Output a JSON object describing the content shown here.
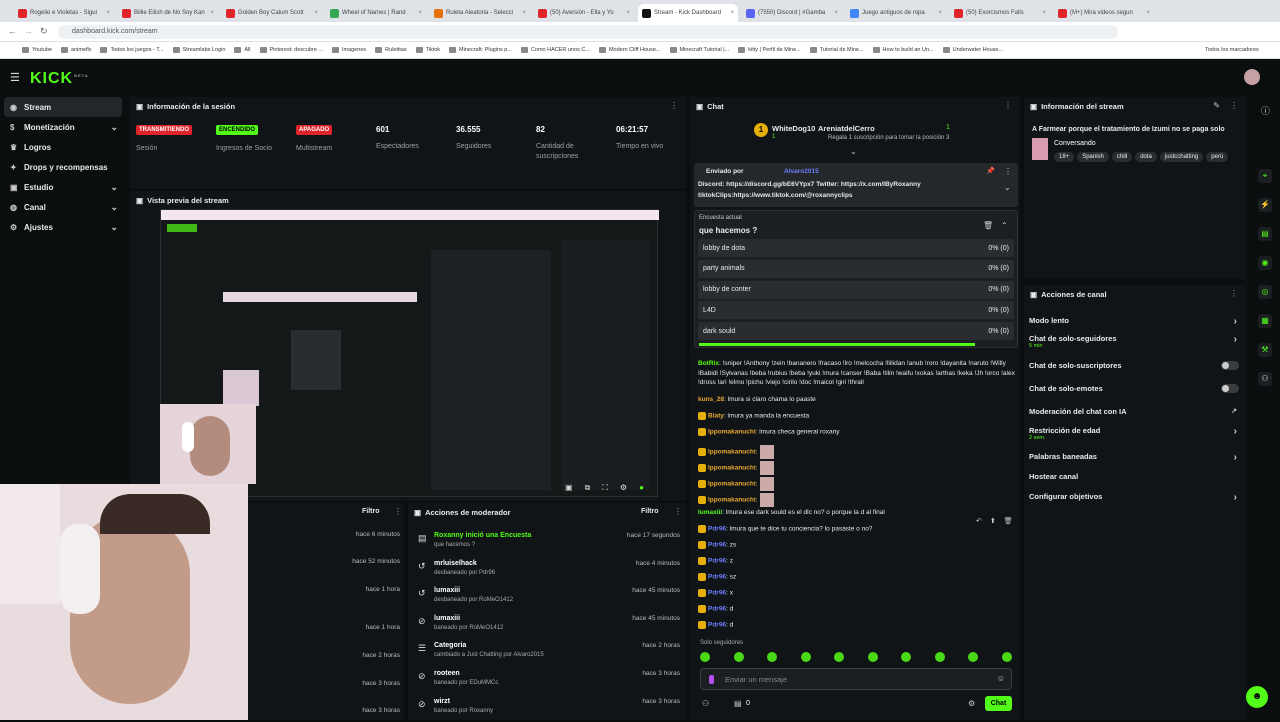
{
  "browser": {
    "tabs": [
      "Rogelio e Violetas - Sigui",
      "Billie Eilish de No Soy Kan",
      "Golden Boy Calum Scott",
      "Wheel of Names | Rand",
      "Ruleta Aleatoria - Selecci",
      "(50) Aversión - Ella y Yo",
      "Stream - Kick Dashboard",
      "(7550) Discord | #Gamba",
      "Juego antiguos de ropa",
      "(50) Exorcismos Falls",
      "(M+) Mira videos segun"
    ],
    "url": "dashboard.kick.com/stream",
    "bookmarks": [
      "Youtube",
      "animeflv",
      "Todos los juegos - T...",
      "Streamlabs Login",
      "All",
      "Pinterest: descubre ...",
      "Imagenes",
      "Ruletitas",
      "Tiktok",
      "Minecraft: Plugins p...",
      "Como HACER unos C...",
      "Modern Cliff House...",
      "Minecraft Tutorial |...",
      "kitty | Perfil de Mine...",
      "Tutorial de Mine...",
      "How to build an Un...",
      "Underwater House..."
    ],
    "bookmarks_right": "Todos los marcadores"
  },
  "kick": {
    "logo": "KICK",
    "beta": "BETA"
  },
  "sidebar": [
    {
      "label": "Stream",
      "icon": "broadcast-icon",
      "active": true
    },
    {
      "label": "Monetización",
      "icon": "money-icon",
      "chev": true
    },
    {
      "label": "Logros",
      "icon": "trophy-icon"
    },
    {
      "label": "Drops y recompensas",
      "icon": "gift-icon"
    },
    {
      "label": "Estudio",
      "icon": "studio-icon",
      "chev": true
    },
    {
      "label": "Canal",
      "icon": "user-icon",
      "chev": true
    },
    {
      "label": "Ajustes",
      "icon": "gear-icon",
      "chev": true
    }
  ],
  "session": {
    "title": "Información de la sesión",
    "badges": [
      {
        "label": "TRANSMITIENDO",
        "sub": "Sesión",
        "color": "#e0242b"
      },
      {
        "label": "ENCENDIDO",
        "sub": "Ingresos de Socio",
        "color": "#53fc18"
      },
      {
        "label": "APAGADO",
        "sub": "Multistream",
        "color": "#e0242b"
      }
    ],
    "stats": [
      {
        "value": "601",
        "label": "Espectadores"
      },
      {
        "value": "36.555",
        "label": "Seguidores"
      },
      {
        "value": "82",
        "label": "Cantidad de suscripciones"
      },
      {
        "value": "06:21:57",
        "label": "Tiempo en vivo"
      }
    ]
  },
  "preview": {
    "title": "Vista previa del stream"
  },
  "left_panel": {
    "filter": "Filtro",
    "times": [
      "hace 6 minutos",
      "hace 52 minutos",
      "hace 1 hora",
      "hace 1 hora",
      "hace 2 horas",
      "hace 3 horas",
      "hace 3 horas"
    ]
  },
  "mod_actions": {
    "title": "Acciones de moderador",
    "filter": "Filtro",
    "items": [
      {
        "title": "Roxanny inició una Encuesta",
        "desc": "que hacemos ?",
        "time": "hace 17 segundos",
        "icon": "poll-icon"
      },
      {
        "title": "mrluiselhack",
        "desc": "desbaneado por Pdr96",
        "time": "hace 4 minutos",
        "icon": "unban-icon"
      },
      {
        "title": "lumaxiii",
        "desc": "desbaneado por RoMeO1412",
        "time": "hace 45 minutos",
        "icon": "unban-icon"
      },
      {
        "title": "lumaxiii",
        "desc": "baneado por RoMeO1412",
        "time": "hace 45 minutos",
        "icon": "ban-icon"
      },
      {
        "title": "Categoria",
        "desc": "cambiado a Just Chatting por Alvaro2015",
        "time": "hace 2 horas",
        "icon": "category-icon"
      },
      {
        "title": "rooteen",
        "desc": "baneado por EDuMMCc",
        "time": "hace 3 horas",
        "icon": "ban-icon"
      },
      {
        "title": "wirzt",
        "desc": "baneado por Roxanny",
        "time": "hace 3 horas",
        "icon": "ban-icon"
      }
    ]
  },
  "chat": {
    "title": "Chat",
    "gifter": {
      "name": "WhiteDog10",
      "count": "1",
      "rank2": "AreniatdelCerro",
      "count2": "1",
      "sub": "Regala 1 suscripción para tomar la posición 3"
    },
    "pinned": {
      "label": "Enviado por",
      "user": "Alvaro2015",
      "line1": "Discord: https://discord.gg/bE6VYpx7 Twitter: https://x.com/IByRoxanny",
      "line2": "tiktokClips:https://www.tiktok.com/@roxannyclips"
    },
    "poll": {
      "label": "Encuesta actual",
      "question": "que hacemos ?",
      "options": [
        {
          "name": "lobby de dota",
          "pct": "0% (0)"
        },
        {
          "name": "party animals",
          "pct": "0% (0)"
        },
        {
          "name": "lobby de conter",
          "pct": "0% (0)"
        },
        {
          "name": "L4D",
          "pct": "0% (0)"
        },
        {
          "name": "dark sould",
          "pct": "0% (0)"
        }
      ]
    },
    "messages": [
      {
        "user": "BotRix",
        "color": "#53fc18",
        "text": ": !sniper !Anthony !zein !bananero !fracaso !lro !melcocha !llilidan !anub !roro !dayanita !naruto !Willy !Babidi !Sylvanas !beba !rubius !beba !yuki !mura !canser !Baba !tilin !waifu !xokas !arthas !keka !Jh !orco !alex !dross !ari !elmo !pichu !viejo !cirilo !doc !maicol !giri !thrall"
      },
      {
        "user": "kuns_28",
        "color": "#e7a834",
        "text": ": lmura si claro chama lo paaste"
      },
      {
        "user": "Blaty",
        "color": "#e7a834",
        "text": ": lmura ya manda la encuesta"
      },
      {
        "user": "lppomakanuchi",
        "color": "#e7a834",
        "text": ": lmura checa general roxany"
      },
      {
        "user": "lppomakanuchi",
        "color": "#e7a834",
        "text": ":"
      },
      {
        "user": "lppomakanuchi",
        "color": "#e7a834",
        "text": ":"
      },
      {
        "user": "lppomakanuchi",
        "color": "#e7a834",
        "text": ":"
      },
      {
        "user": "lppomakanuchi",
        "color": "#e7a834",
        "text": ":"
      },
      {
        "user": "lumaxiii",
        "color": "#53fc18",
        "text": ": lmura ese dark sould es el dlc no? o porque la d al final"
      },
      {
        "user": "Pdr96",
        "color": "#6f7dff",
        "text": ": lmura que te dice tu conciencia? lo pasaste o no?"
      },
      {
        "user": "Pdr96",
        "color": "#6f7dff",
        "text": ": zs"
      },
      {
        "user": "Pdr96",
        "color": "#6f7dff",
        "text": ": z"
      },
      {
        "user": "Pdr96",
        "color": "#6f7dff",
        "text": ": sz"
      },
      {
        "user": "Pdr96",
        "color": "#6f7dff",
        "text": ": x"
      },
      {
        "user": "Pdr96",
        "color": "#6f7dff",
        "text": ": d"
      },
      {
        "user": "Pdr96",
        "color": "#6f7dff",
        "text": ": d"
      }
    ],
    "followers_only": "Solo seguidores",
    "placeholder": "Enviar un mensaje",
    "send": "Chat",
    "count": "0"
  },
  "stream_info": {
    "title": "Información del stream",
    "stream_title": "A Farmear porque el tratamiento de Izumi no se paga solo",
    "category": "Conversando",
    "tags": [
      "18+",
      "Spanish",
      "chill",
      "dota",
      "justcchatting",
      "perú"
    ]
  },
  "channel_actions": {
    "title": "Acciones de canal",
    "items": [
      {
        "label": "Modo lento",
        "kind": "arrow"
      },
      {
        "label": "Chat de solo-seguidores",
        "sub": "5 min",
        "kind": "arrow"
      },
      {
        "label": "Chat de solo-suscriptores",
        "kind": "toggle"
      },
      {
        "label": "Chat de solo-emotes",
        "kind": "toggle"
      },
      {
        "label": "Moderación del chat con IA",
        "kind": "link"
      },
      {
        "label": "Restricción de edad",
        "sub": "2 sem.",
        "kind": "arrow"
      },
      {
        "label": "Palabras baneadas",
        "kind": "arrow"
      },
      {
        "label": "Hostear canal",
        "kind": "none"
      },
      {
        "label": "Configurar objetivos",
        "kind": "arrow"
      }
    ]
  }
}
